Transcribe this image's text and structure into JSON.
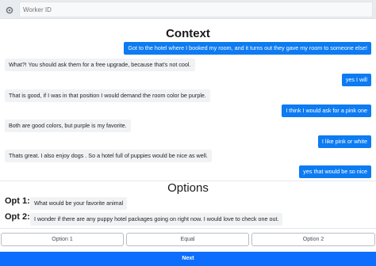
{
  "header": {
    "settings_icon": "gear-icon",
    "worker_id_placeholder": "Worker ID",
    "worker_id_value": ""
  },
  "context": {
    "title": "Context",
    "messages": [
      {
        "side": "right",
        "text": "Got to the hotel where I booked my room, and it turns out they gave my room to someone else!"
      },
      {
        "side": "left",
        "text": "What?! You should ask them for a free upgrade, because that's not cool."
      },
      {
        "side": "right",
        "text": "yes I will"
      },
      {
        "side": "left",
        "text": "That is good, if I was in that position I would demand the room color be purple."
      },
      {
        "side": "right",
        "text": "I think I would ask for a pink one"
      },
      {
        "side": "left",
        "text": "Both are good colors, but purple is my favorite."
      },
      {
        "side": "right",
        "text": "I like pink or white"
      },
      {
        "side": "left",
        "text": "Thats great. I also enjoy dogs . So a hotel full of puppies would be nice as well."
      },
      {
        "side": "right",
        "text": "yes that would be so nice"
      }
    ]
  },
  "options": {
    "title": "Options",
    "items": [
      {
        "label": "Opt 1:",
        "text": "What would be your favorite animal"
      },
      {
        "label": "Opt 2:",
        "text": "I wonder if there are any puppy hotel packages going on right now. I would love to check one out."
      }
    ]
  },
  "choices": {
    "option1": "Option 1",
    "equal": "Equal",
    "option2": "Option 2"
  },
  "next_label": "Next",
  "colors": {
    "accent": "#0d7bf2",
    "bubble_left": "#f1f2f4",
    "next_button": "#0d6efd"
  }
}
